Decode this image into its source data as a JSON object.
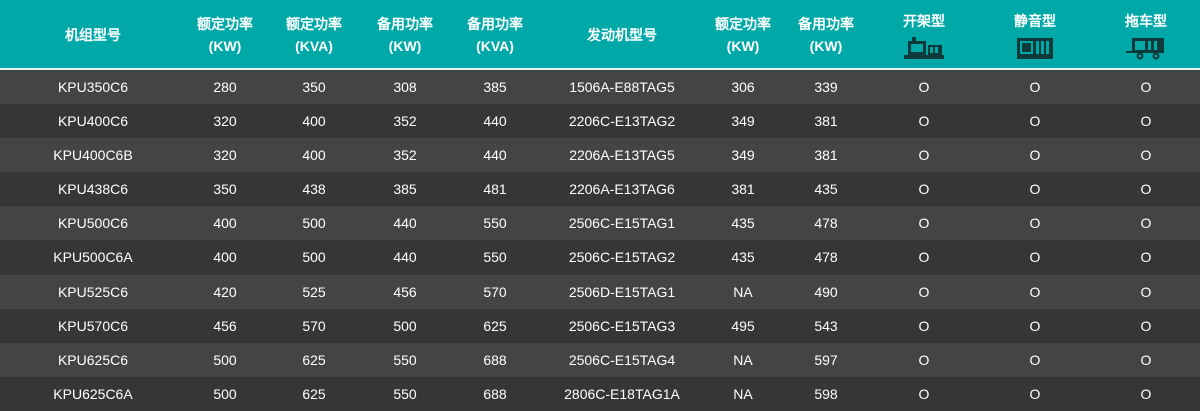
{
  "columns": [
    {
      "label": "机组型号",
      "unit": ""
    },
    {
      "label": "额定功率",
      "unit": "(KW)"
    },
    {
      "label": "额定功率",
      "unit": "(KVA)"
    },
    {
      "label": "备用功率",
      "unit": "(KW)"
    },
    {
      "label": "备用功率",
      "unit": "(KVA)"
    },
    {
      "label": "发动机型号",
      "unit": ""
    },
    {
      "label": "额定功率",
      "unit": "(KW)"
    },
    {
      "label": "备用功率",
      "unit": "(KW)"
    },
    {
      "label": "开架型",
      "unit": "",
      "icon": "open-frame-generator-icon"
    },
    {
      "label": "静音型",
      "unit": "",
      "icon": "silent-generator-icon"
    },
    {
      "label": "拖车型",
      "unit": "",
      "icon": "trailer-generator-icon"
    }
  ],
  "rows": [
    [
      "KPU350C6",
      "280",
      "350",
      "308",
      "385",
      "1506A-E88TAG5",
      "306",
      "339",
      "O",
      "O",
      "O"
    ],
    [
      "KPU400C6",
      "320",
      "400",
      "352",
      "440",
      "2206C-E13TAG2",
      "349",
      "381",
      "O",
      "O",
      "O"
    ],
    [
      "KPU400C6B",
      "320",
      "400",
      "352",
      "440",
      "2206A-E13TAG5",
      "349",
      "381",
      "O",
      "O",
      "O"
    ],
    [
      "KPU438C6",
      "350",
      "438",
      "385",
      "481",
      "2206A-E13TAG6",
      "381",
      "435",
      "O",
      "O",
      "O"
    ],
    [
      "KPU500C6",
      "400",
      "500",
      "440",
      "550",
      "2506C-E15TAG1",
      "435",
      "478",
      "O",
      "O",
      "O"
    ],
    [
      "KPU500C6A",
      "400",
      "500",
      "440",
      "550",
      "2506C-E15TAG2",
      "435",
      "478",
      "O",
      "O",
      "O"
    ],
    [
      "KPU525C6",
      "420",
      "525",
      "456",
      "570",
      "2506D-E15TAG1",
      "NA",
      "490",
      "O",
      "O",
      "O"
    ],
    [
      "KPU570C6",
      "456",
      "570",
      "500",
      "625",
      "2506C-E15TAG3",
      "495",
      "543",
      "O",
      "O",
      "O"
    ],
    [
      "KPU625C6",
      "500",
      "625",
      "550",
      "688",
      "2506C-E15TAG4",
      "NA",
      "597",
      "O",
      "O",
      "O"
    ],
    [
      "KPU625C6A",
      "500",
      "625",
      "550",
      "688",
      "2806C-E18TAG1A",
      "NA",
      "598",
      "O",
      "O",
      "O"
    ]
  ],
  "colors": {
    "header_bg": "#00a9a8",
    "row_odd": "#444444",
    "row_even": "#363636",
    "text": "#ffffff"
  }
}
